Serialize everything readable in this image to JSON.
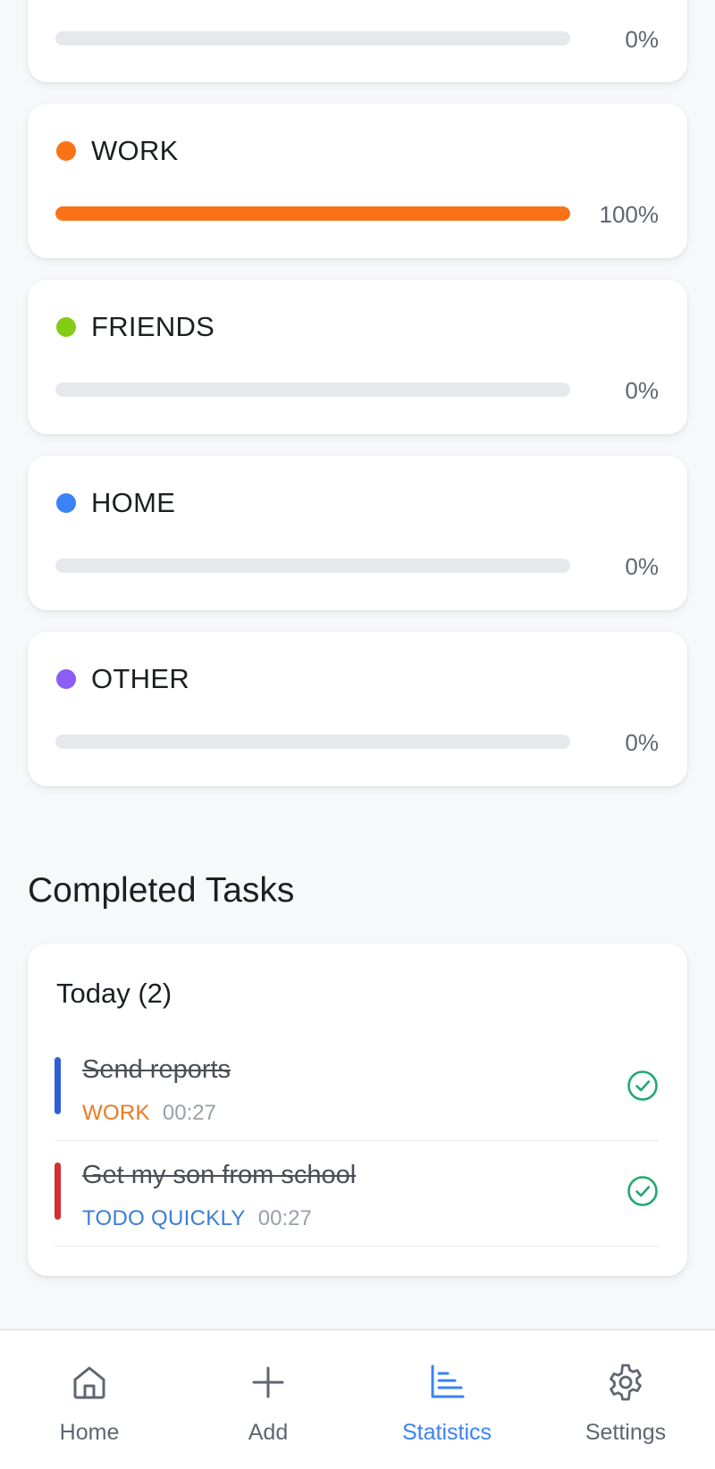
{
  "categories": [
    {
      "name": "",
      "percent_label": "0%",
      "progress": 0,
      "color": "#e6e8ec"
    },
    {
      "name": "WORK",
      "percent_label": "100%",
      "progress": 1.0,
      "color": "#f97316"
    },
    {
      "name": "FRIENDS",
      "percent_label": "0%",
      "progress": 0,
      "color": "#84cc16"
    },
    {
      "name": "HOME",
      "percent_label": "0%",
      "progress": 0,
      "color": "#3b82f6"
    },
    {
      "name": "OTHER",
      "percent_label": "0%",
      "progress": 0,
      "color": "#8b5cf6"
    }
  ],
  "completed": {
    "title": "Completed Tasks",
    "group": "Today (2)",
    "tasks": [
      {
        "title": "Send reports",
        "category": "WORK",
        "category_color": "#ea7a1f",
        "bar_color": "#2f5fd3",
        "time": "00:27",
        "check_icon": "check-circle-icon"
      },
      {
        "title": "Get my son from school",
        "category": "TODO QUICKLY",
        "category_color": "#3b7dd8",
        "bar_color": "#d32f2f",
        "time": "00:27",
        "check_icon": "check-circle-icon"
      }
    ],
    "check_color": "#22a872"
  },
  "nav": {
    "items": [
      {
        "label": "Home",
        "icon": "home-icon",
        "active": false
      },
      {
        "label": "Add",
        "icon": "plus-icon",
        "active": false
      },
      {
        "label": "Statistics",
        "icon": "bar-chart-icon",
        "active": true
      },
      {
        "label": "Settings",
        "icon": "gear-icon",
        "active": false
      }
    ],
    "active_color": "#3b82f6",
    "inactive_color": "#5f6670"
  }
}
